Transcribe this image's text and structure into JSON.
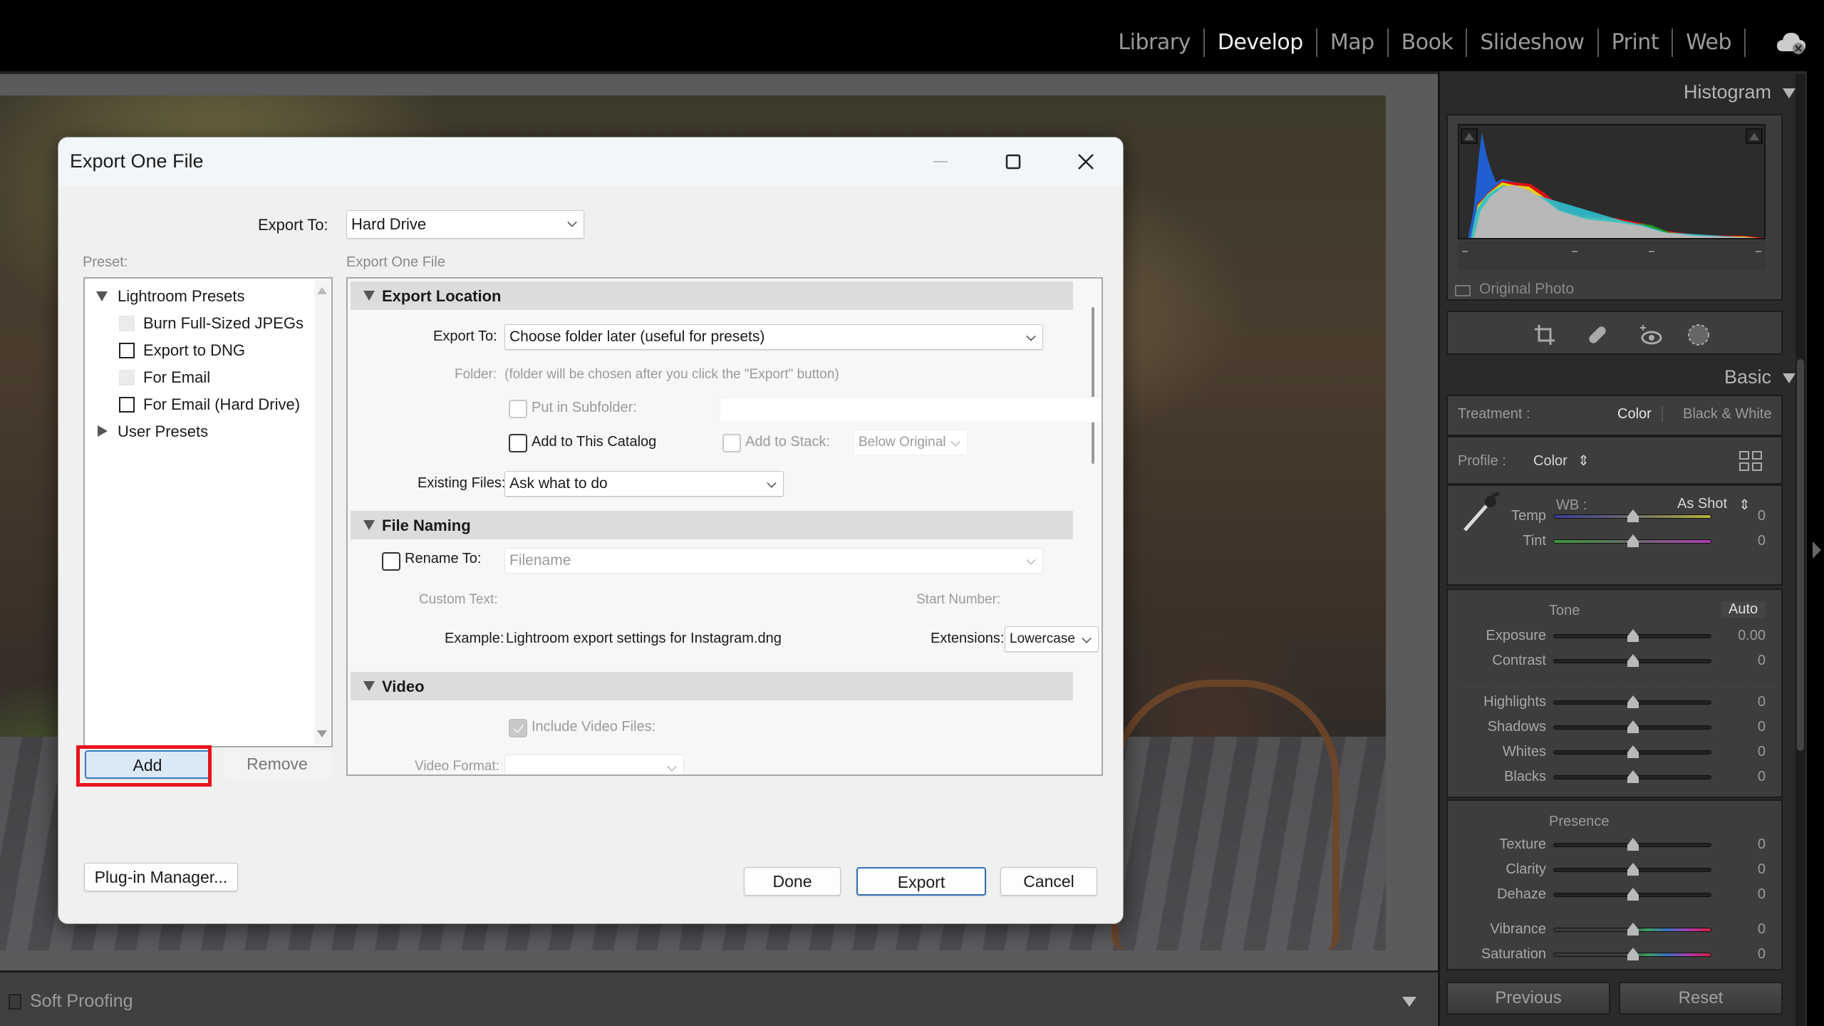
{
  "app": {
    "modules": [
      "Library",
      "Develop",
      "Map",
      "Book",
      "Slideshow",
      "Print",
      "Web"
    ],
    "active_module": "Develop",
    "cloud_icon": "cloud-sync-icon"
  },
  "toolbar": {
    "soft_proofing_label": "Soft Proofing",
    "soft_proofing_checked": false
  },
  "right_panel": {
    "histogram": {
      "title": "Histogram",
      "original_photo_label": "Original Photo",
      "tools": [
        "crop-icon",
        "healing-icon",
        "red-eye-icon",
        "masking-icon"
      ]
    },
    "basic": {
      "title": "Basic",
      "treatment_label": "Treatment :",
      "treatment_options": [
        "Color",
        "Black & White"
      ],
      "treatment_selected": "Color",
      "profile_label": "Profile :",
      "profile_value": "Color",
      "wb_label": "WB :",
      "wb_value": "As Shot",
      "tone_label": "Tone",
      "auto_label": "Auto",
      "presence_label": "Presence",
      "sliders": [
        {
          "label": "Temp",
          "value": "0",
          "position": 0.5
        },
        {
          "label": "Tint",
          "value": "0",
          "position": 0.5
        },
        {
          "label": "Exposure",
          "value": "0.00",
          "position": 0.5
        },
        {
          "label": "Contrast",
          "value": "0",
          "position": 0.5
        },
        {
          "label": "Highlights",
          "value": "0",
          "position": 0.5
        },
        {
          "label": "Shadows",
          "value": "0",
          "position": 0.5
        },
        {
          "label": "Whites",
          "value": "0",
          "position": 0.5
        },
        {
          "label": "Blacks",
          "value": "0",
          "position": 0.5
        },
        {
          "label": "Texture",
          "value": "0",
          "position": 0.5
        },
        {
          "label": "Clarity",
          "value": "0",
          "position": 0.5
        },
        {
          "label": "Dehaze",
          "value": "0",
          "position": 0.5
        },
        {
          "label": "Vibrance",
          "value": "0",
          "position": 0.5
        },
        {
          "label": "Saturation",
          "value": "0",
          "position": 0.5
        }
      ]
    },
    "previous_label": "Previous",
    "reset_label": "Reset"
  },
  "dialog": {
    "title": "Export One File",
    "export_to_label": "Export To:",
    "export_to_value": "Hard Drive",
    "preset_label": "Preset:",
    "settings_label": "Export One File",
    "presets": {
      "lightroom_group": "Lightroom Presets",
      "items": [
        "Burn Full-Sized JPEGs",
        "Export to DNG",
        "For Email",
        "For Email (Hard Drive)"
      ],
      "user_group": "User Presets"
    },
    "add_label": "Add",
    "remove_label": "Remove",
    "plugin_manager_label": "Plug-in Manager...",
    "done_label": "Done",
    "export_label": "Export",
    "cancel_label": "Cancel",
    "export_location": {
      "header": "Export Location",
      "export_to_label": "Export To:",
      "export_to_value": "Choose folder later (useful for presets)",
      "folder_label": "Folder:",
      "folder_value": "(folder will be chosen after you click the \"Export\" button)",
      "subfolder_label": "Put in Subfolder:",
      "add_catalog_label": "Add to This Catalog",
      "add_stack_label": "Add to Stack:",
      "stack_value": "Below Original",
      "existing_files_label": "Existing Files:",
      "existing_files_value": "Ask what to do"
    },
    "file_naming": {
      "header": "File Naming",
      "rename_label": "Rename To:",
      "rename_value": "Filename",
      "custom_text_label": "Custom Text:",
      "start_number_label": "Start Number:",
      "example_label": "Example:",
      "example_value": "Lightroom export settings for Instagram.dng",
      "extensions_label": "Extensions:",
      "extensions_value": "Lowercase"
    },
    "video": {
      "header": "Video",
      "include_label": "Include Video Files:",
      "format_label": "Video Format:"
    }
  }
}
